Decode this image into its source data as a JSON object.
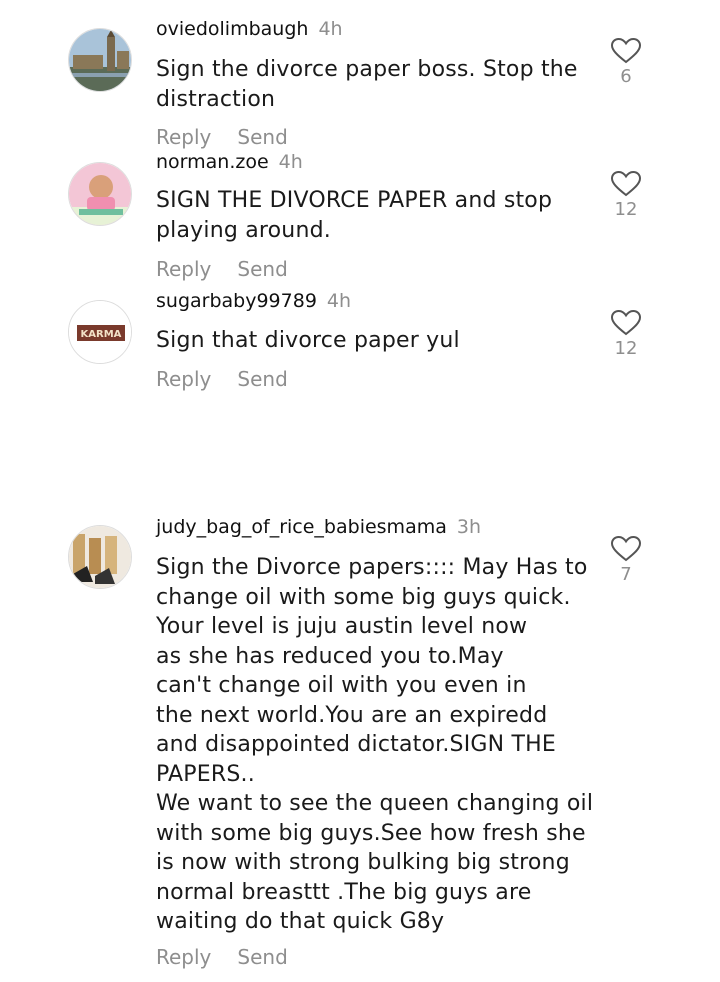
{
  "comments": [
    {
      "username": "oviedolimbaugh",
      "time": "4h",
      "text": "Sign the divorce paper boss. Stop the distraction",
      "likes": "6",
      "reply_label": "Reply",
      "send_label": "Send",
      "avatar_icon": "london-skyline-avatar"
    },
    {
      "username": "norman.zoe",
      "time": "4h",
      "text": "SIGN THE DIVORCE PAPER and stop playing around.",
      "likes": "12",
      "reply_label": "Reply",
      "send_label": "Send",
      "avatar_icon": "baby-photo-avatar"
    },
    {
      "username": "sugarbaby99789",
      "time": "4h",
      "text": "Sign that divorce paper yul",
      "likes": "12",
      "reply_label": "Reply",
      "send_label": "Send",
      "avatar_icon": "karma-sign-avatar",
      "avatar_text": "KARMA"
    },
    {
      "username": "judy_bag_of_rice_babiesmama",
      "time": "3h",
      "text_lines": [
        "Sign the Divorce papers:::: May Has to",
        "change oil with some big guys quick.",
        "Your level is juju austin level now",
        "as she has reduced you to.May",
        "can't change oil with you even in",
        "the next world.You are an expiredd",
        "and disappointed dictator.SIGN THE",
        "PAPERS..",
        "We want to see the queen changing oil",
        "with some big guys.See how fresh she",
        "is now with strong bulking big strong",
        "normal breasttt .The big guys are",
        "waiting do that quick G8y"
      ],
      "likes": "7",
      "reply_label": "Reply",
      "send_label": "Send",
      "avatar_icon": "shoes-photo-avatar"
    }
  ],
  "colors": {
    "text": "#1a1a1a",
    "muted": "#8e8e8e",
    "background": "#ffffff"
  }
}
